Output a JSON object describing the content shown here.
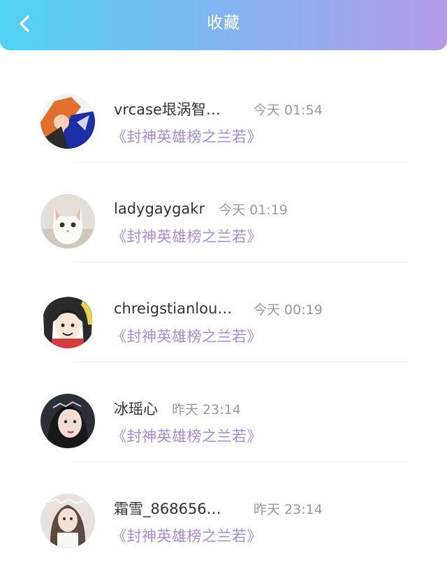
{
  "header": {
    "title": "收藏",
    "back_icon": "chevron-left-icon"
  },
  "items": [
    {
      "name": "vrcase垠涡智…",
      "time": "今天 01:54",
      "book": "《封神英雄榜之兰若》"
    },
    {
      "name": "ladygaygakr",
      "time": "今天 01:19",
      "book": "《封神英雄榜之兰若》"
    },
    {
      "name": "chreigstianlou…",
      "time": "今天 00:19",
      "book": "《封神英雄榜之兰若》"
    },
    {
      "name": "冰瑶心",
      "time": "昨天 23:14",
      "book": "《封神英雄榜之兰若》"
    },
    {
      "name": "霜雪_868656…",
      "time": "昨天 23:14",
      "book": "《封神英雄榜之兰若》"
    }
  ],
  "colors": {
    "header_start": "#4fd3f3",
    "header_end": "#b39ae9",
    "book_title": "#a98ad8",
    "time": "#9a9a9a"
  }
}
